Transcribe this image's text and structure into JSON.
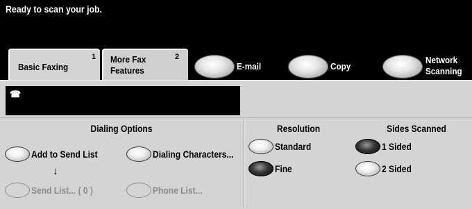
{
  "status": {
    "message": "Ready to scan your job."
  },
  "tabs": [
    {
      "label_line1": "Basic Faxing",
      "label_line2": "",
      "number": "1"
    },
    {
      "label_line1": "More Fax",
      "label_line2": "Features",
      "number": "2"
    }
  ],
  "services": [
    {
      "label_line1": "E-mail",
      "label_line2": ""
    },
    {
      "label_line1": "Copy",
      "label_line2": ""
    },
    {
      "label_line1": "Network",
      "label_line2": "Scanning"
    }
  ],
  "display": {
    "icon": "telephone-icon",
    "glyph": "☎",
    "value": ""
  },
  "dialing_options": {
    "heading": "Dialing Options",
    "add_to_send_list": "Add to Send List",
    "dialing_characters": "Dialing Characters...",
    "arrow": "↓",
    "send_list": "Send List... ( 0 )",
    "phone_list": "Phone List..."
  },
  "resolution": {
    "heading": "Resolution",
    "options": [
      "Standard",
      "Fine"
    ],
    "selected": "Fine"
  },
  "sides_scanned": {
    "heading": "Sides Scanned",
    "options": [
      "1 Sided",
      "2 Sided"
    ],
    "selected": "1 Sided"
  },
  "colors": {
    "background": "#d4d4d4",
    "banner": "#000000",
    "disabled_text": "#8c8c8c"
  }
}
